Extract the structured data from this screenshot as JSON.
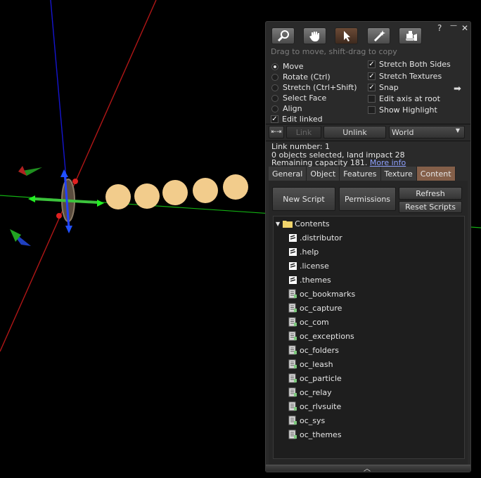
{
  "window": {
    "help_glyph": "?",
    "minimize_glyph": "—",
    "close_glyph": "✕"
  },
  "toolbar": {
    "hint": "Drag to move, shift-drag to copy",
    "tools": [
      "zoom",
      "grab",
      "edit",
      "create",
      "land"
    ],
    "active_tool": "edit"
  },
  "modes": {
    "move": "Move",
    "rotate": "Rotate (Ctrl)",
    "stretch": "Stretch (Ctrl+Shift)",
    "select_face": "Select Face",
    "align": "Align",
    "edit_linked": "Edit linked",
    "selected": "move"
  },
  "options": {
    "stretch_both_sides": "Stretch Both Sides",
    "stretch_textures": "Stretch Textures",
    "snap": "Snap",
    "edit_axis_at_root": "Edit axis at root",
    "show_highlight": "Show Highlight"
  },
  "link_bar": {
    "link": "Link",
    "unlink": "Unlink",
    "world": "World"
  },
  "info": {
    "link_number": "Link number: 1",
    "objects_selected": "0 objects selected, land impact 28",
    "remaining_capacity": "Remaining capacity 181.",
    "more_info": "More info"
  },
  "tabs": [
    "General",
    "Object",
    "Features",
    "Texture",
    "Content"
  ],
  "active_tab": "Content",
  "content": {
    "new_script": "New Script",
    "permissions": "Permissions",
    "refresh": "Refresh",
    "reset_scripts": "Reset Scripts",
    "folder": "Contents",
    "notecards": [
      ".distributor",
      ".help",
      ".license",
      ".themes"
    ],
    "scripts": [
      "oc_bookmarks",
      "oc_capture",
      "oc_com",
      "oc_exceptions",
      "oc_folders",
      "oc_leash",
      "oc_particle",
      "oc_relay",
      "oc_rlvsuite",
      "oc_sys",
      "oc_themes"
    ]
  },
  "colors": {
    "active_tab": "#845f49",
    "link_text": "#8fa2ff",
    "sphere": "#f0c98a"
  }
}
